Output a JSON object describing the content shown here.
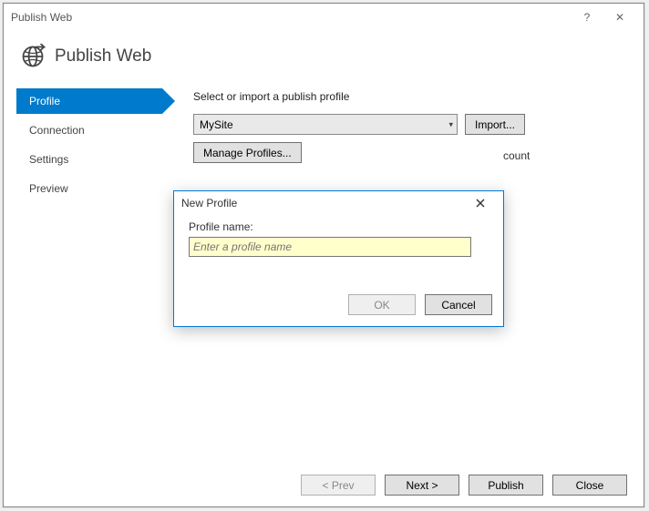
{
  "window": {
    "title": "Publish Web",
    "help": "?",
    "close": "✕"
  },
  "header": {
    "title": "Publish Web"
  },
  "sidebar": {
    "items": [
      {
        "label": "Profile",
        "active": true
      },
      {
        "label": "Connection",
        "active": false
      },
      {
        "label": "Settings",
        "active": false
      },
      {
        "label": "Preview",
        "active": false
      }
    ]
  },
  "content": {
    "section_label": "Select or import a publish profile",
    "profile_dropdown": {
      "value": "MySite"
    },
    "import_button": "Import...",
    "manage_button": "Manage Profiles...",
    "account_hint_fragment": "count"
  },
  "modal": {
    "title": "New Profile",
    "close": "✕",
    "label": "Profile name:",
    "input_value": "",
    "input_placeholder": "Enter a profile name",
    "ok": "OK",
    "cancel": "Cancel"
  },
  "footer": {
    "prev": "< Prev",
    "next": "Next >",
    "publish": "Publish",
    "close": "Close"
  }
}
